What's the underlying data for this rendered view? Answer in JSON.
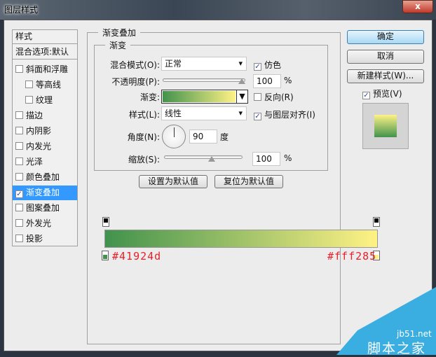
{
  "window": {
    "title": "图层样式",
    "close": "x"
  },
  "sidebar": {
    "header": "样式",
    "blend": "混合选项:默认",
    "items": [
      {
        "label": "斜面和浮雕",
        "checked": false,
        "indent": false
      },
      {
        "label": "等高线",
        "checked": false,
        "indent": true
      },
      {
        "label": "纹理",
        "checked": false,
        "indent": true
      },
      {
        "label": "描边",
        "checked": false,
        "indent": false
      },
      {
        "label": "内阴影",
        "checked": false,
        "indent": false
      },
      {
        "label": "内发光",
        "checked": false,
        "indent": false
      },
      {
        "label": "光泽",
        "checked": false,
        "indent": false
      },
      {
        "label": "颜色叠加",
        "checked": false,
        "indent": false
      },
      {
        "label": "渐变叠加",
        "checked": true,
        "indent": false,
        "selected": true
      },
      {
        "label": "图案叠加",
        "checked": false,
        "indent": false
      },
      {
        "label": "外发光",
        "checked": false,
        "indent": false
      },
      {
        "label": "投影",
        "checked": false,
        "indent": false
      }
    ]
  },
  "main": {
    "group": "渐变叠加",
    "subgroup": "渐变",
    "blend_mode": {
      "label": "混合模式(O):",
      "value": "正常"
    },
    "dither": {
      "label": "仿色",
      "checked": true
    },
    "opacity": {
      "label": "不透明度(P):",
      "value": "100",
      "unit": "%",
      "fraction": 1.0
    },
    "gradient": {
      "label": "渐变:"
    },
    "reverse": {
      "label": "反向(R)",
      "checked": false
    },
    "style": {
      "label": "样式(L):",
      "value": "线性"
    },
    "align": {
      "label": "与图层对齐(I)",
      "checked": true
    },
    "angle": {
      "label": "角度(N):",
      "value": "90",
      "unit": "度"
    },
    "scale": {
      "label": "缩放(S):",
      "value": "100",
      "unit": "%",
      "fraction": 0.5
    },
    "set_default": "设置为默认值",
    "reset_default": "复位为默认值"
  },
  "right": {
    "ok": "确定",
    "cancel": "取消",
    "new_style": "新建样式(W)...",
    "preview": {
      "label": "预览(V)",
      "checked": true
    }
  },
  "gradient_editor": {
    "start_color": "#41924d",
    "end_color": "#fff285",
    "start_label": "#41924d",
    "end_label": "#fff285"
  },
  "watermark": {
    "site": "jb51.net",
    "name": "脚本之家"
  }
}
